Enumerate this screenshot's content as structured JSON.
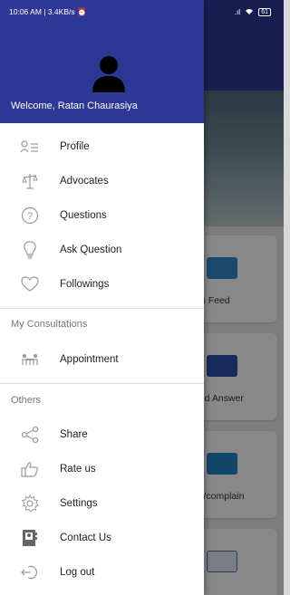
{
  "status_bar": {
    "left_text": "10:06 AM | 3.4KB/s ⏰",
    "signal": ".ıl",
    "battery": "61"
  },
  "drawer": {
    "welcome_text": "Welcome, Ratan Chaurasiya",
    "menu_items": [
      {
        "label": "Profile",
        "icon": "profile-icon"
      },
      {
        "label": "Advocates",
        "icon": "scales-icon"
      },
      {
        "label": "Questions",
        "icon": "question-icon"
      },
      {
        "label": "Ask Question",
        "icon": "bulb-icon"
      },
      {
        "label": "Followings",
        "icon": "heart-icon"
      }
    ],
    "section_consultations": "My Consultations",
    "consultation_items": [
      {
        "label": "Appointment",
        "icon": "meeting-icon"
      }
    ],
    "section_others": "Others",
    "other_items": [
      {
        "label": "Share",
        "icon": "share-icon"
      },
      {
        "label": "Rate us",
        "icon": "thumbs-up-icon"
      },
      {
        "label": "Settings",
        "icon": "gear-icon"
      },
      {
        "label": "Contact Us",
        "icon": "contact-icon"
      },
      {
        "label": "Log out",
        "icon": "logout-icon"
      }
    ]
  },
  "background": {
    "cards": [
      {
        "label": "ws Feed"
      },
      {
        "label": "and Answer"
      },
      {
        "label": "ck/complain"
      },
      {
        "label": ""
      }
    ]
  }
}
